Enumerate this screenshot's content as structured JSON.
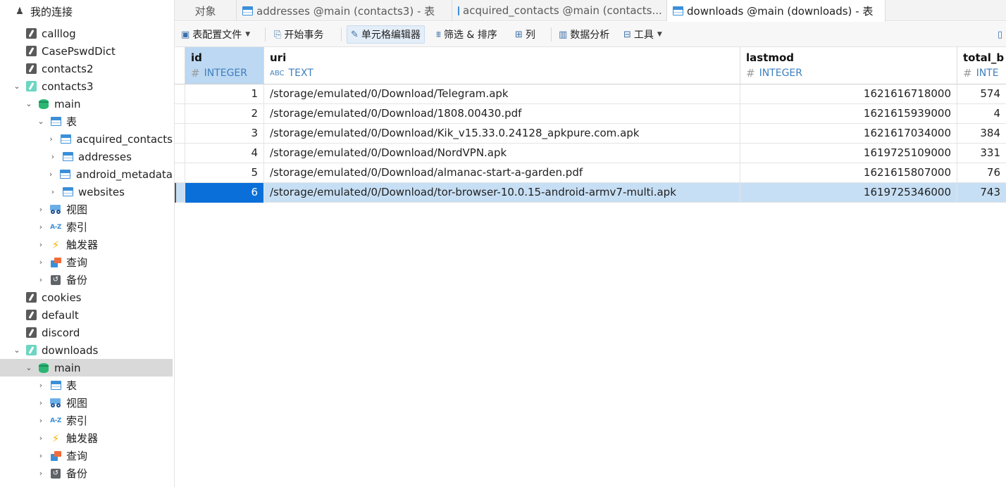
{
  "sidebar": {
    "root": "我的连接",
    "items": [
      {
        "label": "calllog"
      },
      {
        "label": "CasePswdDict"
      },
      {
        "label": "contacts2"
      },
      {
        "label": "contacts3"
      },
      {
        "label": "main"
      },
      {
        "label": "表"
      },
      {
        "label": "acquired_contacts"
      },
      {
        "label": "addresses"
      },
      {
        "label": "android_metadata"
      },
      {
        "label": "websites"
      },
      {
        "label": "视图"
      },
      {
        "label": "索引"
      },
      {
        "label": "触发器"
      },
      {
        "label": "查询"
      },
      {
        "label": "备份"
      },
      {
        "label": "cookies"
      },
      {
        "label": "default"
      },
      {
        "label": "discord"
      },
      {
        "label": "downloads"
      },
      {
        "label": "main"
      },
      {
        "label": "表"
      },
      {
        "label": "视图"
      },
      {
        "label": "索引"
      },
      {
        "label": "触发器"
      },
      {
        "label": "查询"
      },
      {
        "label": "备份"
      }
    ]
  },
  "tabs": [
    {
      "label": "对象"
    },
    {
      "label": "addresses @main (contacts3) - 表"
    },
    {
      "label": "acquired_contacts @main (contacts..."
    },
    {
      "label": "downloads @main (downloads) - 表"
    }
  ],
  "toolbar": {
    "table_config": "表配置文件",
    "begin_transaction": "开始事务",
    "cell_editor": "单元格编辑器",
    "filter_sort": "筛选 & 排序",
    "columns": "列",
    "data_analysis": "数据分析",
    "tools": "工具"
  },
  "table": {
    "columns": [
      {
        "name": "id",
        "type": "INTEGER",
        "type_icon": "#"
      },
      {
        "name": "uri",
        "type": "TEXT",
        "type_icon": "ABC"
      },
      {
        "name": "lastmod",
        "type": "INTEGER",
        "type_icon": "#"
      },
      {
        "name": "total_b",
        "type": "INTE",
        "type_icon": "#"
      }
    ],
    "rows": [
      {
        "id": "1",
        "uri": "/storage/emulated/0/Download/Telegram.apk",
        "lastmod": "1621616718000",
        "total": "574"
      },
      {
        "id": "2",
        "uri": "/storage/emulated/0/Download/1808.00430.pdf",
        "lastmod": "1621615939000",
        "total": "4"
      },
      {
        "id": "3",
        "uri": "/storage/emulated/0/Download/Kik_v15.33.0.24128_apkpure.com.apk",
        "lastmod": "1621617034000",
        "total": "384"
      },
      {
        "id": "4",
        "uri": "/storage/emulated/0/Download/NordVPN.apk",
        "lastmod": "1619725109000",
        "total": "331"
      },
      {
        "id": "5",
        "uri": "/storage/emulated/0/Download/almanac-start-a-garden.pdf",
        "lastmod": "1621615807000",
        "total": "76"
      },
      {
        "id": "6",
        "uri": "/storage/emulated/0/Download/tor-browser-10.0.15-android-armv7-multi.apk",
        "lastmod": "1619725346000",
        "total": "743"
      }
    ]
  }
}
